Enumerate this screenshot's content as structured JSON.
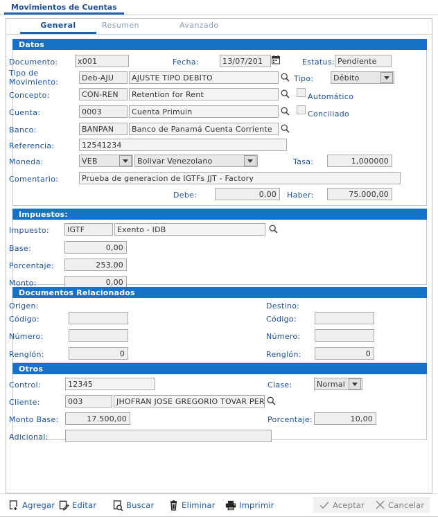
{
  "window": {
    "tab_title": "Movimientos de Cuentas"
  },
  "tabs": [
    {
      "label": "General",
      "active": true
    },
    {
      "label": "Resumen",
      "active": false
    },
    {
      "label": "Avanzado",
      "active": false
    }
  ],
  "sections": {
    "datos": {
      "title": "Datos",
      "labels": {
        "documento": "Documento:",
        "fecha": "Fecha:",
        "estatus": "Estatus:",
        "tipo_movimiento_l1": "Tipo de",
        "tipo_movimiento_l2": "Movimiento:",
        "tipo": "Tipo:",
        "concepto": "Concepto:",
        "automatico": "Automático",
        "cuenta": "Cuenta:",
        "conciliado": "Conciliado",
        "banco": "Banco:",
        "referencia": "Referencia:",
        "moneda": "Moneda:",
        "tasa": "Tasa:",
        "comentario": "Comentario:",
        "debe": "Debe:",
        "haber": "Haber:"
      },
      "values": {
        "documento": "x001",
        "fecha": "13/07/201",
        "estatus": "Pendiente",
        "tipo_movimiento_code": "Deb-AJU",
        "tipo_movimiento_desc": "AJUSTE TIPO DEBITO",
        "tipo": "Débito",
        "concepto_code": "CON-REN",
        "concepto_desc": "Retention for Rent",
        "cuenta_code": "0003",
        "cuenta_desc": "Cuenta Primuin",
        "banco_code": "BANPAN",
        "banco_desc": "Banco de Panamá Cuenta Corriente",
        "referencia": "12541234",
        "moneda_code": "VEB",
        "moneda_desc": "Bolivar Venezolano",
        "tasa": "1,000000",
        "comentario": "Prueba de generacion de IGTFs JJT - Factory",
        "debe": "0,00",
        "haber": "75.000,00",
        "automatico_checked": false,
        "conciliado_checked": false
      }
    },
    "impuestos": {
      "title": "Impuestos:",
      "labels": {
        "impuesto": "Impuesto:",
        "base": "Base:",
        "porcentaje": "Porcentaje:",
        "monto": "Monto:"
      },
      "values": {
        "impuesto_code": "IGTF",
        "impuesto_desc": "Exento - IDB",
        "base": "0,00",
        "porcentaje": "253,00",
        "monto": "0,00"
      }
    },
    "documentos_relacionados": {
      "title": "Documentos Relacionados",
      "labels": {
        "origen": "Origen:",
        "origen_codigo": "Código:",
        "origen_numero": "Número:",
        "origen_renglon": "Renglón:",
        "destino": "Destino:",
        "destino_codigo": "Código:",
        "destino_numero": "Número:",
        "destino_renglon": "Renglón:"
      },
      "values": {
        "origen_codigo": "",
        "origen_numero": "",
        "origen_renglon": "0",
        "destino_codigo": "",
        "destino_numero": "",
        "destino_renglon": "0"
      }
    },
    "otros": {
      "title": "Otros",
      "labels": {
        "control": "Control:",
        "clase": "Clase:",
        "cliente": "Cliente:",
        "monto_base": "Monto Base:",
        "porcentaje": "Porcentaje:",
        "adicional": "Adicional:"
      },
      "values": {
        "control": "12345",
        "clase": "Normal",
        "cliente_code": "003",
        "cliente_desc": "JHOFRAN JOSE GREGORIO TOVAR PER",
        "monto_base": "17.500,00",
        "porcentaje": "10,00",
        "adicional": ""
      }
    }
  },
  "toolbar": {
    "agregar": "Agregar",
    "editar": "Editar",
    "buscar": "Buscar",
    "eliminar": "Eliminar",
    "imprimir": "Imprimir",
    "aceptar": "Aceptar",
    "cancelar": "Cancelar"
  },
  "colors": {
    "section_header": "#1673c8",
    "label_blue": "#1a4f9c",
    "tab_active": "#1f5fb4",
    "tab_idle": "#8c9cb4",
    "field_bg": "#efefef",
    "disabled_text": "#808080"
  }
}
